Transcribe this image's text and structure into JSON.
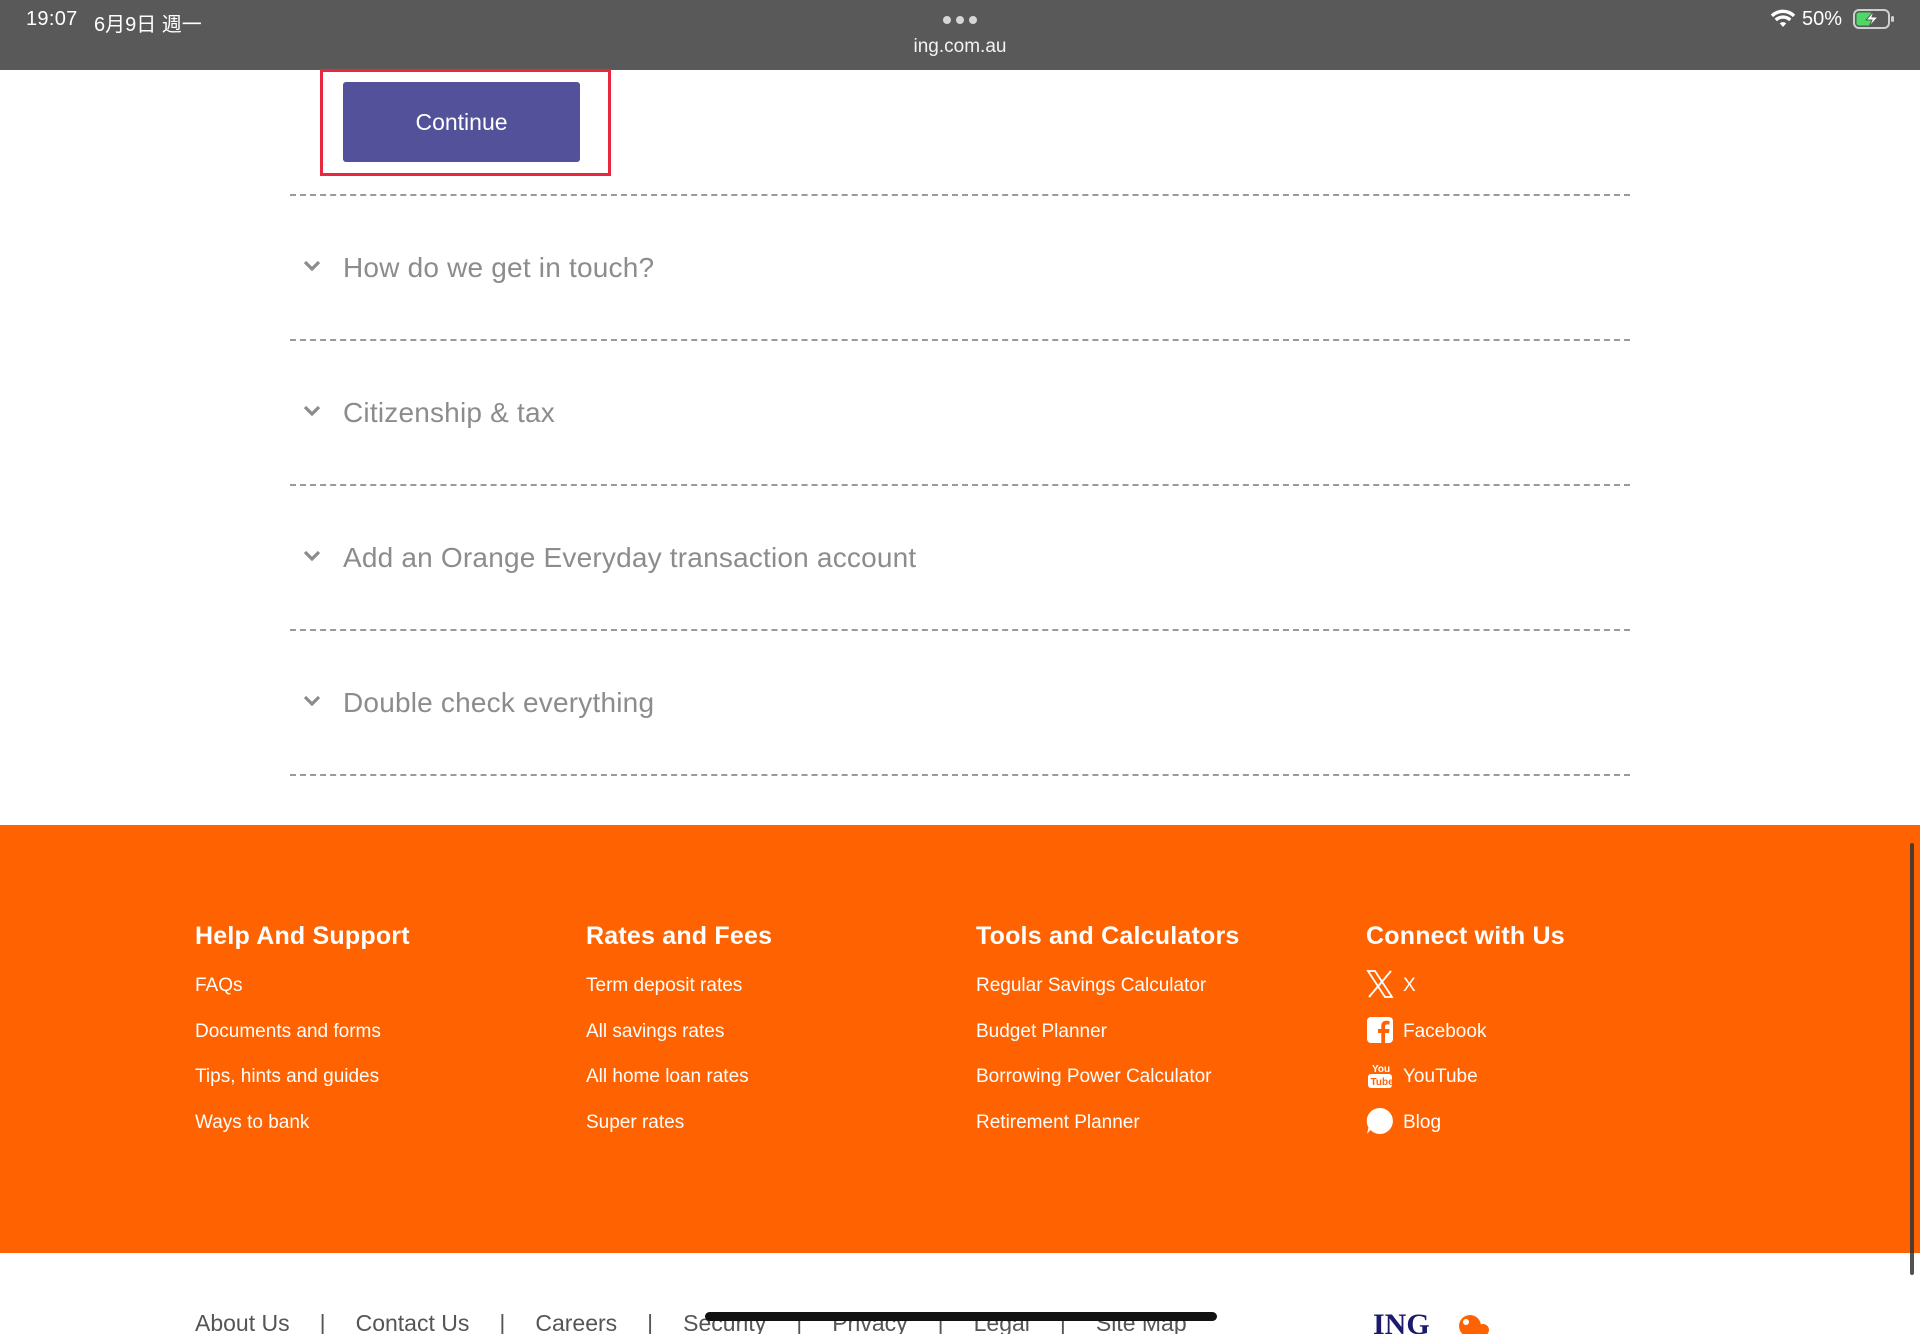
{
  "status_bar": {
    "time": "19:07",
    "date": "6月9日 週一",
    "url": "ing.com.au",
    "battery": "50%"
  },
  "form": {
    "continue_label": "Continue"
  },
  "accordion": {
    "items": [
      {
        "title": "How do we get in touch?"
      },
      {
        "title": "Citizenship & tax"
      },
      {
        "title": "Add an Orange Everyday transaction account"
      },
      {
        "title": "Double check everything"
      }
    ]
  },
  "footer": {
    "columns": [
      {
        "heading": "Help And Support",
        "links": [
          "FAQs",
          "Documents and forms",
          "Tips, hints and guides",
          "Ways to bank"
        ]
      },
      {
        "heading": "Rates and Fees",
        "links": [
          "Term deposit rates",
          "All savings rates",
          "All home loan rates",
          "Super rates"
        ]
      },
      {
        "heading": "Tools and Calculators",
        "links": [
          "Regular Savings Calculator",
          "Budget Planner",
          "Borrowing Power Calculator",
          "Retirement Planner"
        ]
      },
      {
        "heading": "Connect with Us",
        "links": [
          {
            "label": "X",
            "icon": "x-icon"
          },
          {
            "label": "Facebook",
            "icon": "facebook-icon"
          },
          {
            "label": "YouTube",
            "icon": "youtube-icon"
          },
          {
            "label": "Blog",
            "icon": "blog-icon"
          }
        ]
      }
    ]
  },
  "bottom_links": [
    "About Us",
    "Contact Us",
    "Careers",
    "Security",
    "Privacy",
    "Legal",
    "Site Map"
  ],
  "logo": {
    "text": "ING",
    "icon": "ing-lion-logo"
  },
  "colors": {
    "footer_bg": "#ff6200",
    "button_bg": "#525199",
    "highlight_frame": "#e8283f",
    "status_bar_bg": "#595959"
  }
}
